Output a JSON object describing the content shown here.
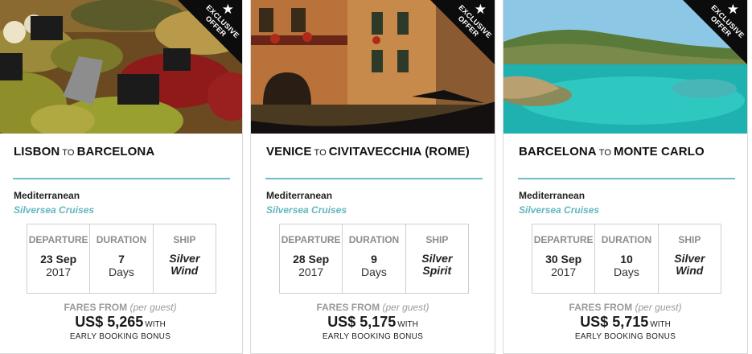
{
  "ribbon": {
    "line1": "EXCLUSIVE",
    "line2": "OFFER",
    "icon": "star-icon"
  },
  "labels": {
    "departure": "DEPARTURE",
    "duration": "DURATION",
    "ship": "SHIP",
    "fares_from": "FARES FROM",
    "per_guest": "(per guest)",
    "with": "WITH",
    "early_booking_bonus": "EARLY BOOKING BONUS",
    "to": "TO"
  },
  "colors": {
    "accent": "#6bbec4",
    "cruise_line": "#62b6c0",
    "ribbon": "#0c0c0c"
  },
  "cards": [
    {
      "image": "olive-market-photo",
      "from": "LISBON",
      "to": "BARCELONA",
      "region": "Mediterranean",
      "cruise_line": "Silversea Cruises",
      "departure_date": "23 Sep",
      "departure_year": "2017",
      "duration_value": "7",
      "duration_unit": "Days",
      "ship_line1": "Silver",
      "ship_line2": "Wind",
      "price": "US$ 5,265"
    },
    {
      "image": "venice-canal-photo",
      "from": "VENICE",
      "to": "CIVITAVECCHIA (ROME)",
      "region": "Mediterranean",
      "cruise_line": "Silversea Cruises",
      "departure_date": "28 Sep",
      "departure_year": "2017",
      "duration_value": "9",
      "duration_unit": "Days",
      "ship_line1": "Silver",
      "ship_line2": "Spirit",
      "price": "US$ 5,175"
    },
    {
      "image": "coastal-bay-photo",
      "from": "BARCELONA",
      "to": "MONTE CARLO",
      "region": "Mediterranean",
      "cruise_line": "Silversea Cruises",
      "departure_date": "30 Sep",
      "departure_year": "2017",
      "duration_value": "10",
      "duration_unit": "Days",
      "ship_line1": "Silver",
      "ship_line2": "Wind",
      "price": "US$ 5,715"
    }
  ]
}
